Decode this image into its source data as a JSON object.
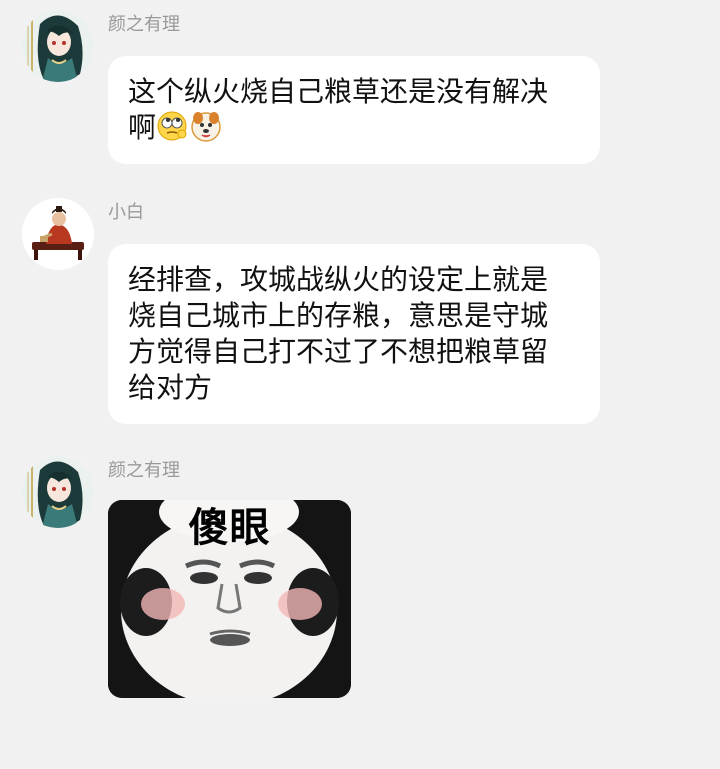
{
  "messages": [
    {
      "sender": "颜之有理",
      "lines": [
        "这个纵火烧自己粮草还是没有解决",
        "啊"
      ],
      "emojis": [
        "rolling-eyes-thinking-emoji",
        "dog-face-emoji"
      ]
    },
    {
      "sender": "小白",
      "lines": [
        "经排查，攻城战纵火的设定上就是",
        "烧自己城市上的存粮，意思是守城",
        "方觉得自己打不过了不想把粮草留",
        "给对方"
      ]
    },
    {
      "sender": "颜之有理",
      "sticker_caption": "傻眼"
    }
  ]
}
